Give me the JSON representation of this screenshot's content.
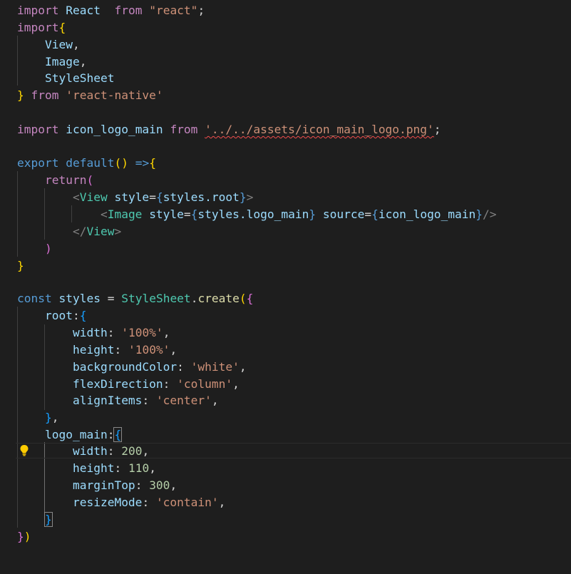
{
  "colors": {
    "background": "#1e1e1e",
    "keyword_control": "#c586c0",
    "keyword_storage": "#569cd6",
    "variable": "#9cdcfe",
    "type": "#4ec9b0",
    "string": "#ce9178",
    "number": "#b5cea8",
    "function": "#dcdcaa",
    "bracket_1": "#ffd700",
    "bracket_2": "#da70d6",
    "bracket_3": "#179fff",
    "error_squiggle": "#f14c4c"
  },
  "lightbulb_icon": "lightbulb-icon",
  "code": {
    "l1": {
      "import_kw": "import",
      "react": "React",
      "from_kw": "from",
      "module": "\"react\"",
      "semi": ";"
    },
    "l2": {
      "import_kw": "import",
      "brace": "{"
    },
    "l3": {
      "name": "View",
      "comma": ","
    },
    "l4": {
      "name": "Image",
      "comma": ","
    },
    "l5": {
      "name": "StyleSheet"
    },
    "l6": {
      "brace": "}",
      "from_kw": "from",
      "module": "'react-native'"
    },
    "l8": {
      "import_kw": "import",
      "name": "icon_logo_main",
      "from_kw": "from",
      "path": "'../../assets/icon_main_logo.png'",
      "semi": ";"
    },
    "l10": {
      "export_kw": "export",
      "default_kw": "default",
      "parens": "()",
      "arrow": "=>",
      "brace": "{"
    },
    "l11": {
      "return_kw": "return",
      "paren": "("
    },
    "l12": {
      "open": "<",
      "tag": "View",
      "attr": "style",
      "eq": "=",
      "lb": "{",
      "expr": "styles.root",
      "rb": "}",
      "close": ">"
    },
    "l13": {
      "open": "<",
      "tag": "Image",
      "attr1": "style",
      "eq1": "=",
      "lb1": "{",
      "expr1": "styles.logo_main",
      "rb1": "}",
      "attr2": "source",
      "eq2": "=",
      "lb2": "{",
      "expr2": "icon_logo_main",
      "rb2": "}",
      "close": "/>"
    },
    "l14": {
      "open": "</",
      "tag": "View",
      "close": ">"
    },
    "l15": {
      "paren": ")"
    },
    "l16": {
      "brace": "}"
    },
    "l18": {
      "const_kw": "const",
      "name": "styles",
      "eq": "=",
      "obj": "StyleSheet",
      "dot": ".",
      "fn": "create",
      "paren": "(",
      "brace": "{"
    },
    "l19": {
      "key": "root",
      "colon": ":",
      "brace": "{"
    },
    "l20": {
      "key": "width",
      "colon": ": ",
      "value": "'100%'",
      "comma": ","
    },
    "l21": {
      "key": "height",
      "colon": ": ",
      "value": "'100%'",
      "comma": ","
    },
    "l22": {
      "key": "backgroundColor",
      "colon": ": ",
      "value": "'white'",
      "comma": ","
    },
    "l23": {
      "key": "flexDirection",
      "colon": ": ",
      "value": "'column'",
      "comma": ","
    },
    "l24": {
      "key": "alignItems",
      "colon": ": ",
      "value": "'center'",
      "comma": ","
    },
    "l25": {
      "brace": "}",
      "comma": ","
    },
    "l26": {
      "key": "logo_main",
      "colon": ":",
      "brace": "{"
    },
    "l27": {
      "key": "width",
      "colon": ": ",
      "value": "200",
      "comma": ","
    },
    "l28": {
      "key": "height",
      "colon": ": ",
      "value": "110",
      "comma": ","
    },
    "l29": {
      "key": "marginTop",
      "colon": ": ",
      "value": "300",
      "comma": ","
    },
    "l30": {
      "key": "resizeMode",
      "colon": ": ",
      "value": "'contain'",
      "comma": ","
    },
    "l31": {
      "brace": "}"
    },
    "l32": {
      "brace": "}",
      "paren": ")"
    }
  }
}
